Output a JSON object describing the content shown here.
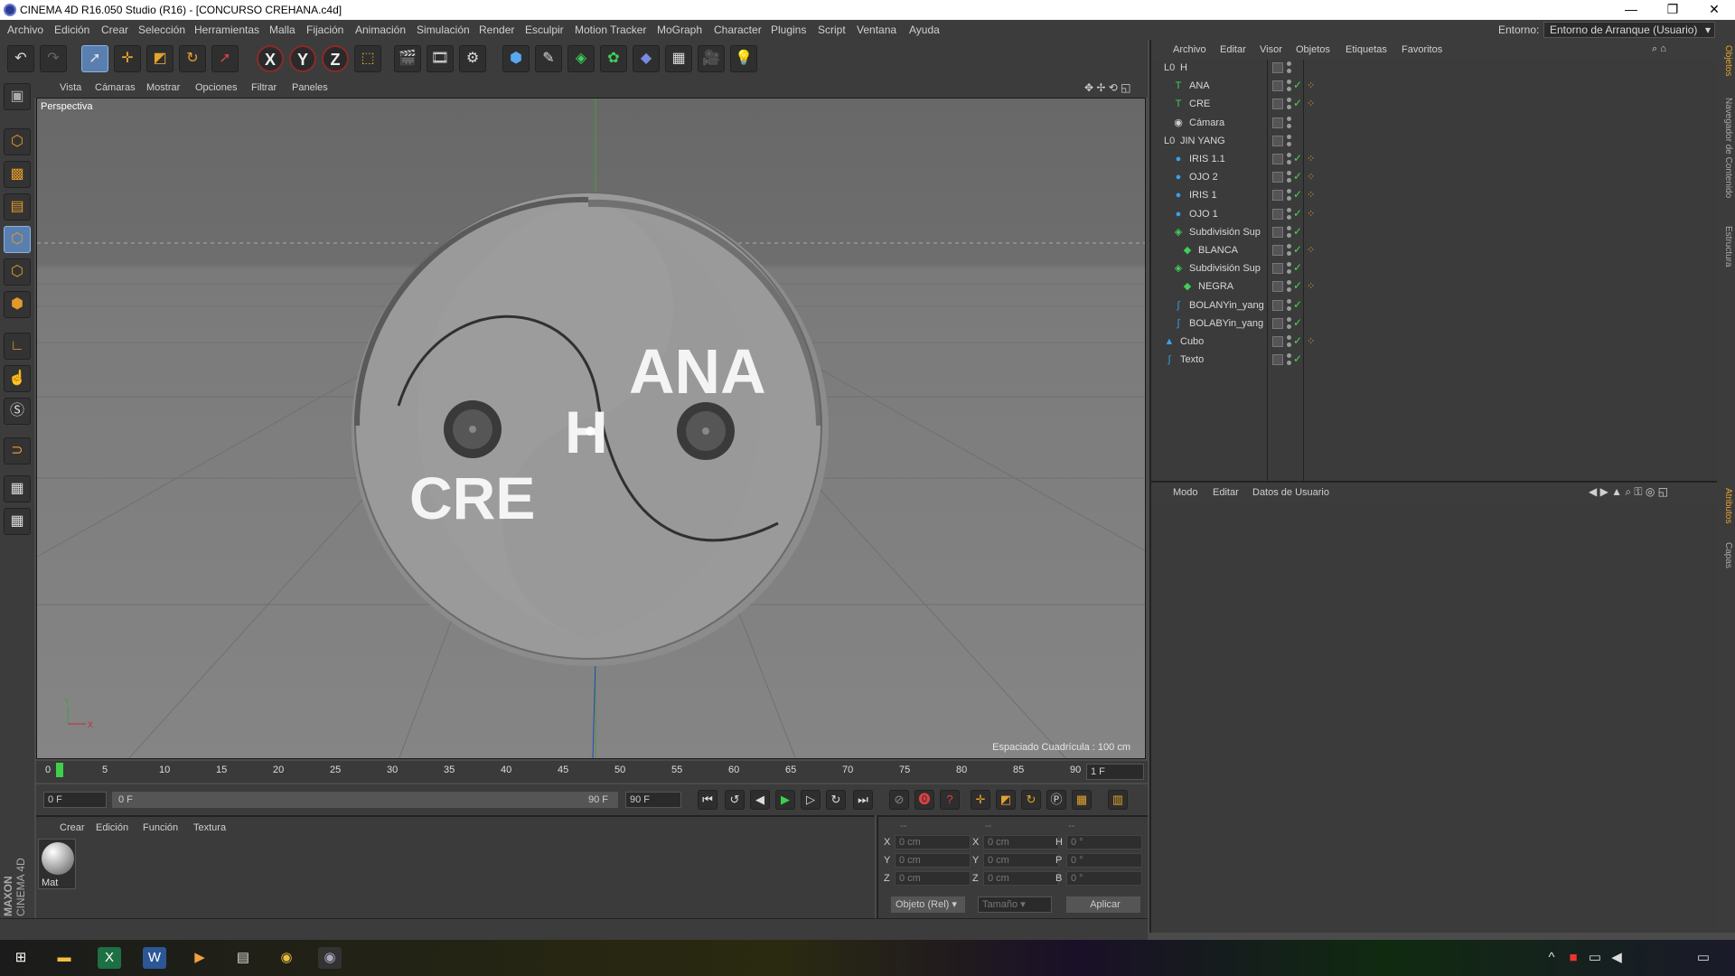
{
  "window": {
    "title": "CINEMA 4D R16.050 Studio (R16) - [CONCURSO CREHANA.c4d]"
  },
  "menu": [
    "Archivo",
    "Edición",
    "Crear",
    "Selección",
    "Herramientas",
    "Malla",
    "Fijación",
    "Animación",
    "Simulación",
    "Render",
    "Esculpir",
    "Motion Tracker",
    "MoGraph",
    "Character",
    "Plugins",
    "Script",
    "Ventana",
    "Ayuda"
  ],
  "environment": {
    "label": "Entorno:",
    "value": "Entorno de Arranque (Usuario)"
  },
  "viewport": {
    "menu": [
      "Vista",
      "Cámaras",
      "Mostrar",
      "Opciones",
      "Filtrar",
      "Paneles"
    ],
    "label": "Perspectiva",
    "grid_info": "Espaciado Cuadrícula : 100 cm",
    "scene_text": {
      "ana": "ANA",
      "cre": "CRE",
      "h": "H"
    }
  },
  "objects": {
    "menu": [
      "Archivo",
      "Editar",
      "Visor",
      "Objetos",
      "Etiquetas",
      "Favoritos"
    ],
    "items": [
      {
        "name": "H",
        "icon": "null-icon",
        "color": "#d0d0d0"
      },
      {
        "name": "ANA",
        "icon": "text-icon",
        "color": "#3fd05a"
      },
      {
        "name": "CRE",
        "icon": "text-icon",
        "color": "#3fd05a"
      },
      {
        "name": "Cámara",
        "icon": "camera-icon",
        "color": "#d0d0d0"
      },
      {
        "name": "JIN YANG",
        "icon": "null-icon",
        "color": "#d0d0d0"
      },
      {
        "name": "IRIS 1.1",
        "icon": "sphere-icon",
        "color": "#3aa0e8"
      },
      {
        "name": "OJO 2",
        "icon": "sphere-icon",
        "color": "#3aa0e8"
      },
      {
        "name": "IRIS 1",
        "icon": "sphere-icon",
        "color": "#3aa0e8"
      },
      {
        "name": "OJO 1",
        "icon": "sphere-icon",
        "color": "#3aa0e8"
      },
      {
        "name": "Subdivisión Sup",
        "icon": "subdivision-icon",
        "color": "#3fd05a"
      },
      {
        "name": "BLANCA",
        "icon": "extrude-icon",
        "color": "#3fd05a"
      },
      {
        "name": "Subdivisión Sup",
        "icon": "subdivision-icon",
        "color": "#3fd05a"
      },
      {
        "name": "NEGRA",
        "icon": "extrude-icon",
        "color": "#3fd05a"
      },
      {
        "name": "BOLANYin_yang",
        "icon": "spline-icon",
        "color": "#3aa0e8"
      },
      {
        "name": "BOLABYin_yang",
        "icon": "spline-icon",
        "color": "#3aa0e8"
      },
      {
        "name": "Cubo",
        "icon": "cube-icon",
        "color": "#3aa0e8"
      },
      {
        "name": "Texto",
        "icon": "spline-icon",
        "color": "#3aa0e8"
      }
    ]
  },
  "attributes": {
    "menu": [
      "Modo",
      "Editar",
      "Datos de Usuario"
    ]
  },
  "side_tabs": [
    "Objetos",
    "Navegador de Contenido",
    "Estructura",
    "Atributos",
    "Capas"
  ],
  "timeline": {
    "ticks": [
      "0",
      "5",
      "10",
      "15",
      "20",
      "25",
      "30",
      "35",
      "40",
      "45",
      "50",
      "55",
      "60",
      "65",
      "70",
      "75",
      "80",
      "85",
      "90"
    ],
    "current_frame": "1 F",
    "start_field": "0 F",
    "range_start": "0 F",
    "range_end": "90 F",
    "end_field": "90 F"
  },
  "materials": {
    "menu": [
      "Crear",
      "Edición",
      "Función",
      "Textura"
    ],
    "items": [
      {
        "name": "Mat"
      }
    ]
  },
  "coordinates": {
    "headers": [
      "--",
      "--",
      "--"
    ],
    "rows": [
      {
        "a": "X",
        "av": "0 cm",
        "b": "X",
        "bv": "0 cm",
        "c": "H",
        "cv": "0 °"
      },
      {
        "a": "Y",
        "av": "0 cm",
        "b": "Y",
        "bv": "0 cm",
        "c": "P",
        "cv": "0 °"
      },
      {
        "a": "Z",
        "av": "0 cm",
        "b": "Z",
        "bv": "0 cm",
        "c": "B",
        "cv": "0 °"
      }
    ],
    "mode": "Objeto (Rel)",
    "size": "Tamaño",
    "apply": "Aplicar"
  },
  "brand": {
    "maxon": "MAXON",
    "product": "CINEMA 4D"
  }
}
